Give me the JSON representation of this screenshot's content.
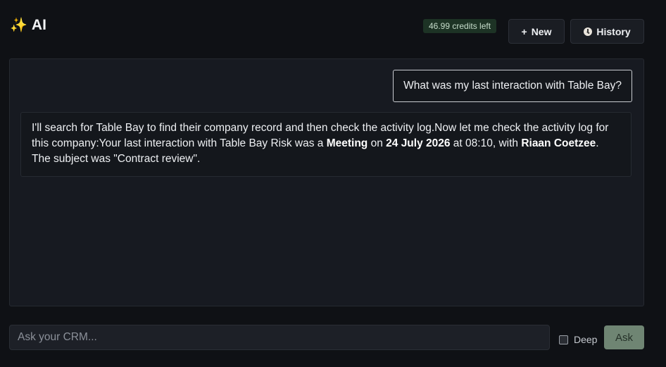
{
  "header": {
    "title_icon": "sparkles-icon",
    "title": "AI",
    "credits": "46.99 credits left",
    "new_label": "New",
    "history_label": "History"
  },
  "chat": {
    "user_message": "What was my last interaction with Table Bay?",
    "ai_response": {
      "part1": "I'll search for Table Bay to find their company record and then check the activity log.Now let me check the activity log for this company:Your last interaction with Table Bay Risk was a ",
      "type_bold": "Meeting",
      "part2": " on ",
      "date_bold": "24 July 2026",
      "part3": " at 08:10, with ",
      "person_bold": "Riaan Coetzee",
      "part4": ". The subject was \"Contract review\"."
    }
  },
  "composer": {
    "placeholder": "Ask your CRM...",
    "deep_label": "Deep",
    "ask_label": "Ask"
  },
  "colors": {
    "background": "#0f1115",
    "panel": "#171a21",
    "credits_bg": "#1d3325",
    "ask_button": "#6f8573"
  }
}
